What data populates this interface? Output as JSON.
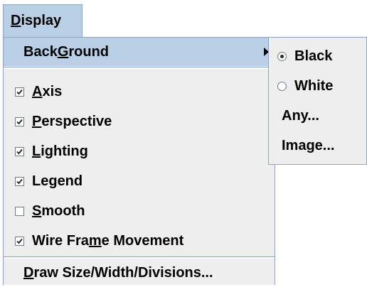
{
  "menubar": {
    "display_menu": {
      "pre": "",
      "mnemonic": "D",
      "post": "isplay"
    }
  },
  "display_menu": {
    "background": {
      "pre": "Back",
      "mnemonic": "G",
      "post": "round"
    },
    "items": [
      {
        "pre": "",
        "mnemonic": "A",
        "post": "xis",
        "checked": true
      },
      {
        "pre": "",
        "mnemonic": "P",
        "post": "erspective",
        "checked": true
      },
      {
        "pre": "",
        "mnemonic": "L",
        "post": "ighting",
        "checked": true
      },
      {
        "pre": "Le",
        "mnemonic": "g",
        "post": "end",
        "checked": true
      },
      {
        "pre": "",
        "mnemonic": "S",
        "post": "mooth",
        "checked": false
      },
      {
        "pre": "Wire Fra",
        "mnemonic": "m",
        "post": "e Movement",
        "checked": true
      }
    ],
    "draw_size": {
      "pre": "",
      "mnemonic": "D",
      "post": "raw Size/Width/Divisions..."
    }
  },
  "background_submenu": {
    "items": [
      {
        "label": "Black",
        "type": "radio",
        "selected": true
      },
      {
        "label": "White",
        "type": "radio",
        "selected": false
      },
      {
        "label": "Any...",
        "type": "plain"
      },
      {
        "label": "Image...",
        "type": "plain"
      }
    ]
  },
  "colors": {
    "highlight": "#b8cfe5",
    "menu_bg": "#eeeeee",
    "border": "#8da5be"
  }
}
